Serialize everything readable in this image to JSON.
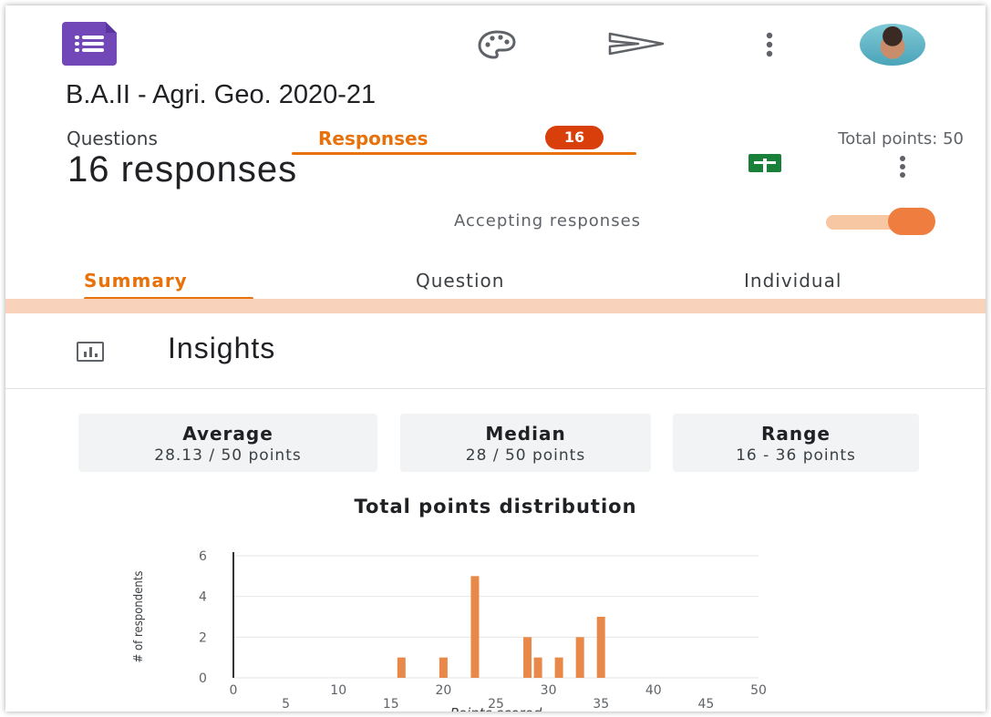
{
  "app": {
    "form_title": "B.A.II - Agri. Geo. 2020-21",
    "icons": [
      "forms-logo-icon",
      "palette-icon",
      "send-icon",
      "more-vert-icon",
      "avatar"
    ]
  },
  "top_tabs": {
    "questions": "Questions",
    "responses": "Responses",
    "responses_badge": "16",
    "total_points": "Total points: 50"
  },
  "responses_header": {
    "count_text": "16 responses",
    "accepting_label": "Accepting responses",
    "accepting_on": true
  },
  "sub_tabs": {
    "summary": "Summary",
    "question": "Question",
    "individual": "Individual",
    "active": "Summary"
  },
  "insights": {
    "title": "Insights",
    "stats": [
      {
        "label": "Average",
        "value": "28.13 / 50 points"
      },
      {
        "label": "Median",
        "value": "28 / 50 points"
      },
      {
        "label": "Range",
        "value": "16 - 36 points"
      }
    ]
  },
  "colors": {
    "accent": "#e8710a",
    "bar": "#e8894a",
    "badge": "#d93f0b",
    "sheets_green": "#188038",
    "forms_purple": "#7248b9"
  },
  "chart_data": {
    "type": "bar",
    "title": "Total points distribution",
    "xlabel": "Points scored",
    "ylabel": "# of respondents",
    "xlim": [
      0,
      50
    ],
    "ylim": [
      0,
      6
    ],
    "x_ticks_upper": [
      "0",
      "10",
      "20",
      "30",
      "40",
      "50"
    ],
    "x_ticks_lower": [
      "5",
      "15",
      "25",
      "35",
      "45"
    ],
    "y_ticks": [
      "0",
      "2",
      "4",
      "6"
    ],
    "grid": true,
    "x": [
      16,
      20,
      23,
      28,
      29,
      31,
      33,
      35
    ],
    "values": [
      1,
      1,
      5,
      2,
      1,
      1,
      2,
      3
    ]
  }
}
